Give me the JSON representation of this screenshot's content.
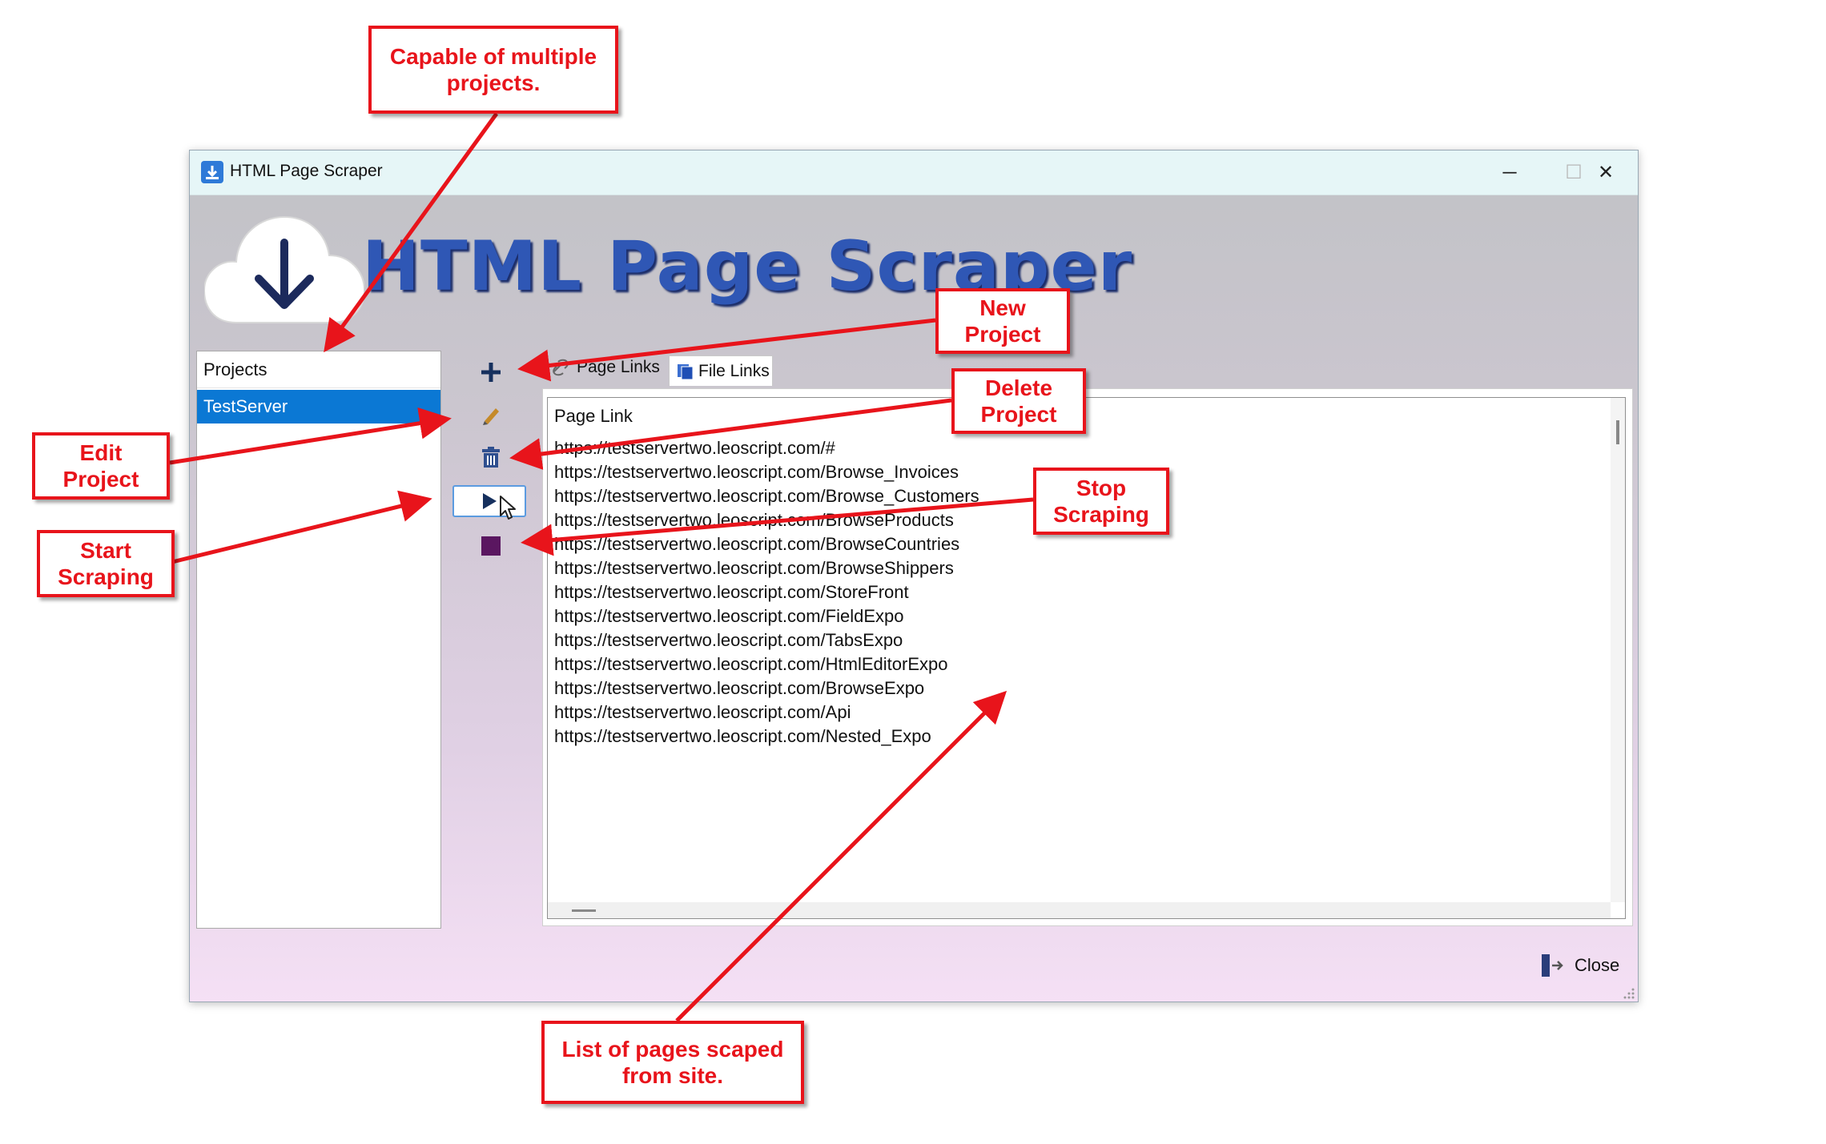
{
  "window": {
    "title": "HTML Page Scraper",
    "minimize_glyph": "─",
    "maximize_glyph": "☐",
    "close_glyph": "✕"
  },
  "banner": {
    "title": "HTML Page Scraper",
    "icon": "cloud-download-icon"
  },
  "projects": {
    "header": "Projects",
    "items": [
      "TestServer"
    ],
    "selected": "TestServer"
  },
  "toolbar": {
    "new_icon": "plus-icon",
    "edit_icon": "pencil-icon",
    "delete_icon": "trash-icon",
    "start_icon": "play-icon",
    "stop_icon": "stop-square-icon"
  },
  "tabs": [
    {
      "label": "Page Links",
      "icon": "link-icon",
      "active": true
    },
    {
      "label": "File Links",
      "icon": "files-icon",
      "active": false
    }
  ],
  "links": {
    "header": "Page Link",
    "rows": [
      "https://testservertwo.leoscript.com/#",
      "https://testservertwo.leoscript.com/Browse_Invoices",
      "https://testservertwo.leoscript.com/Browse_Customers",
      "https://testservertwo.leoscript.com/BrowseProducts",
      "https://testservertwo.leoscript.com/BrowseCountries",
      "https://testservertwo.leoscript.com/BrowseShippers",
      "https://testservertwo.leoscript.com/StoreFront",
      "https://testservertwo.leoscript.com/FieldExpo",
      "https://testservertwo.leoscript.com/TabsExpo",
      "https://testservertwo.leoscript.com/HtmlEditorExpo",
      "https://testservertwo.leoscript.com/BrowseExpo",
      "https://testservertwo.leoscript.com/Api",
      "https://testservertwo.leoscript.com/Nested_Expo"
    ]
  },
  "footer": {
    "close_label": "Close",
    "close_icon": "exit-door-icon"
  },
  "callouts": {
    "multi_projects": [
      "Capable of multiple",
      "projects."
    ],
    "new_project": [
      "New",
      "Project"
    ],
    "delete_project": [
      "Delete",
      "Project"
    ],
    "edit_project": [
      "Edit",
      "Project"
    ],
    "start_scraping": [
      "Start",
      "Scraping"
    ],
    "stop_scraping": [
      "Stop",
      "Scraping"
    ],
    "list_pages": [
      "List of pages scaped",
      "from site."
    ]
  },
  "colors": {
    "callout_red": "#e8141b",
    "selection_blue": "#0b78d4",
    "banner_blue": "#2f57b5",
    "stop_purple": "#5a1660"
  }
}
